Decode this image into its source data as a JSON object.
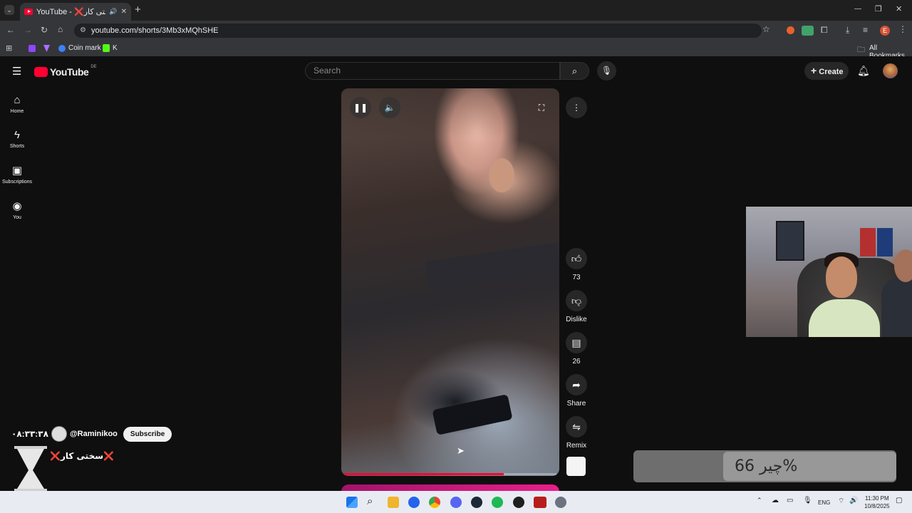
{
  "browser": {
    "tab_title": "YouTube - ❌سختی کار❌",
    "new_tab": "+",
    "url": "youtube.com/shorts/3Mb3xMQhSHE",
    "bookmarks": [
      "Coin mark",
      "K"
    ],
    "all_bookmarks": "All Bookmarks",
    "profile_letter": "E",
    "window_controls": {
      "minimize": "—",
      "restore": "❐",
      "close": "✕"
    }
  },
  "youtube": {
    "logo": "YouTube",
    "region": "DE",
    "search_placeholder": "Search",
    "create_label": "Create",
    "nav": [
      {
        "label": "Home",
        "icon": "home-icon"
      },
      {
        "label": "Shorts",
        "icon": "shorts-icon"
      },
      {
        "label": "Subscriptions",
        "icon": "subscriptions-icon"
      },
      {
        "label": "You",
        "icon": "you-icon"
      }
    ],
    "actions": {
      "like_count": "73",
      "dislike_label": "Dislike",
      "comment_count": "26",
      "share_label": "Share",
      "remix_label": "Remix"
    },
    "progress_fraction": 0.75
  },
  "stream_overlay": {
    "timer": "۰۸:۳۳:۳۸",
    "channel": "@Raminikoo",
    "subscribe": "Subscribe",
    "title": "❌سختی کار❌",
    "goal_text": "چیر 66%"
  },
  "taskbar": {
    "language": "ENG",
    "time": "11:30 PM",
    "date": "10/8/2025"
  },
  "colors": {
    "accent_red": "#ff0033",
    "page_bg": "#0f0f0f"
  }
}
